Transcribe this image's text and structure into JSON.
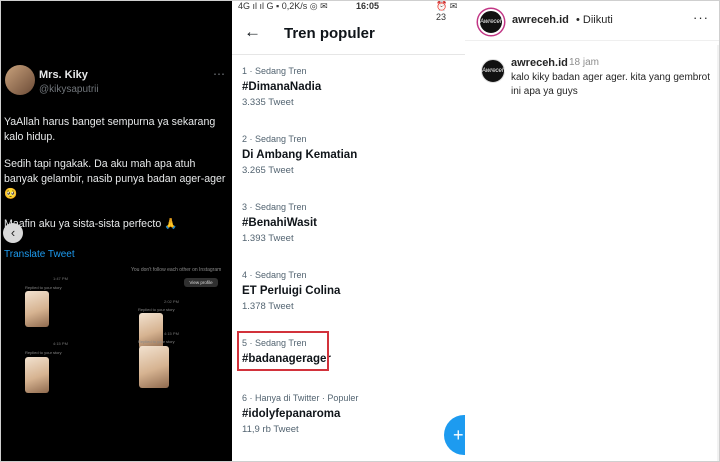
{
  "tweet": {
    "name": "Mrs. Kiky",
    "handle": "@kikysaputrii",
    "more": "⋯",
    "text1": "YaAllah harus banget sempurna ya sekarang kalo hidup.",
    "text2": "Sedih tapi ngakak. Da aku mah apa atuh banyak gelambir, nasib punya badan ager-ager 🥺",
    "text3": "Maafin aku ya sista-sista perfecto 🙏",
    "translate": "Translate Tweet",
    "nav_arrow": "‹",
    "chat": {
      "notice": "You don't follow each other on Instagram",
      "view_profile": "View profile",
      "time1": "1:47 PM",
      "time2": "2:02 PM",
      "time3": "4:15 PM",
      "time4": "4:15 PM",
      "replied": "Replied to your story"
    }
  },
  "trends": {
    "status": {
      "left": "4G ıl ıl G ▪ 0,2K/s ◎ ✉",
      "time": "16:05",
      "right": "⏰ ✉ 23"
    },
    "back": "←",
    "title": "Tren populer",
    "items": [
      {
        "meta": "1 · Sedang Tren",
        "name": "#DimanaNadia",
        "count": "3.335 Tweet"
      },
      {
        "meta": "2 · Sedang Tren",
        "name": "Di Ambang Kematian",
        "count": "3.265 Tweet"
      },
      {
        "meta": "3 · Sedang Tren",
        "name": "#BenahiWasit",
        "count": "1.393 Tweet"
      },
      {
        "meta": "4 · Sedang Tren",
        "name": "ET Perluigi Colina",
        "count": "1.378 Tweet"
      },
      {
        "meta": "5 · Sedang Tren",
        "name": "#badanagerager",
        "count": ""
      },
      {
        "meta": "6 · Hanya di Twitter · Populer",
        "name": "#idolyfepanaroma",
        "count": "11,9 rb Tweet"
      }
    ],
    "fab": "+"
  },
  "instagram": {
    "username": "awreceh.id",
    "follow_status": "• Diikuti",
    "more": "···",
    "avatar_text": "Awreceh",
    "comment_user": "awreceh.id",
    "comment_time": "18 jam",
    "comment_text": "kalo kiky badan ager ager. kita yang gembrot ini apa ya guys"
  },
  "colors": {
    "twitter_blue": "#1d9bf0",
    "highlight_red": "#d2323b",
    "dark_bg": "#000000"
  }
}
